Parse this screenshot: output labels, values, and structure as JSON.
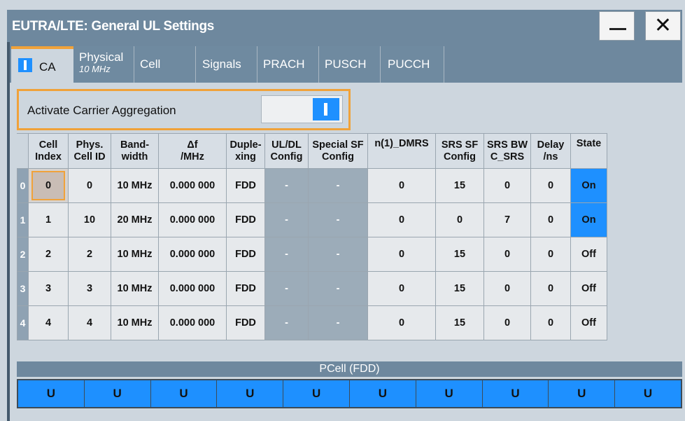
{
  "window": {
    "title": "EUTRA/LTE: General UL Settings"
  },
  "tabs": [
    {
      "label": "CA"
    },
    {
      "label": "Physical",
      "sub": "10 MHz"
    },
    {
      "label": "Cell"
    },
    {
      "label": "Signals"
    },
    {
      "label": "PRACH"
    },
    {
      "label": "PUSCH"
    },
    {
      "label": "PUCCH"
    }
  ],
  "activate": {
    "label": "Activate Carrier Aggregation",
    "state": "on"
  },
  "table": {
    "headers": [
      [
        "Cell",
        "Index"
      ],
      [
        "Phys.",
        "Cell ID"
      ],
      [
        "Band-",
        "width"
      ],
      [
        "Δf",
        "/MHz"
      ],
      [
        "Duple-",
        "xing"
      ],
      [
        "UL/DL",
        "Config"
      ],
      [
        "Special SF",
        "Config"
      ],
      [
        "n(1)_DMRS",
        ""
      ],
      [
        "SRS SF",
        "Config"
      ],
      [
        "SRS BW",
        "C_SRS"
      ],
      [
        "Delay",
        "/ns"
      ],
      [
        "State",
        ""
      ]
    ],
    "rows": [
      {
        "idx": "0",
        "cells": [
          "0",
          "0",
          "10 MHz",
          "0.000 000",
          "FDD",
          "-",
          "-",
          "0",
          "15",
          "0",
          "0",
          "On"
        ]
      },
      {
        "idx": "1",
        "cells": [
          "1",
          "10",
          "20 MHz",
          "0.000 000",
          "FDD",
          "-",
          "-",
          "0",
          "0",
          "7",
          "0",
          "On"
        ]
      },
      {
        "idx": "2",
        "cells": [
          "2",
          "2",
          "10 MHz",
          "0.000 000",
          "FDD",
          "-",
          "-",
          "0",
          "15",
          "0",
          "0",
          "Off"
        ]
      },
      {
        "idx": "3",
        "cells": [
          "3",
          "3",
          "10 MHz",
          "0.000 000",
          "FDD",
          "-",
          "-",
          "0",
          "15",
          "0",
          "0",
          "Off"
        ]
      },
      {
        "idx": "4",
        "cells": [
          "4",
          "4",
          "10 MHz",
          "0.000 000",
          "FDD",
          "-",
          "-",
          "0",
          "15",
          "0",
          "0",
          "Off"
        ]
      }
    ]
  },
  "pcell": {
    "title": "PCell (FDD)",
    "subframes": [
      "U",
      "U",
      "U",
      "U",
      "U",
      "U",
      "U",
      "U",
      "U",
      "U"
    ]
  },
  "colors": {
    "accent": "#f0a23a",
    "active_blue": "#1e90ff",
    "title_bar": "#6e889e"
  }
}
